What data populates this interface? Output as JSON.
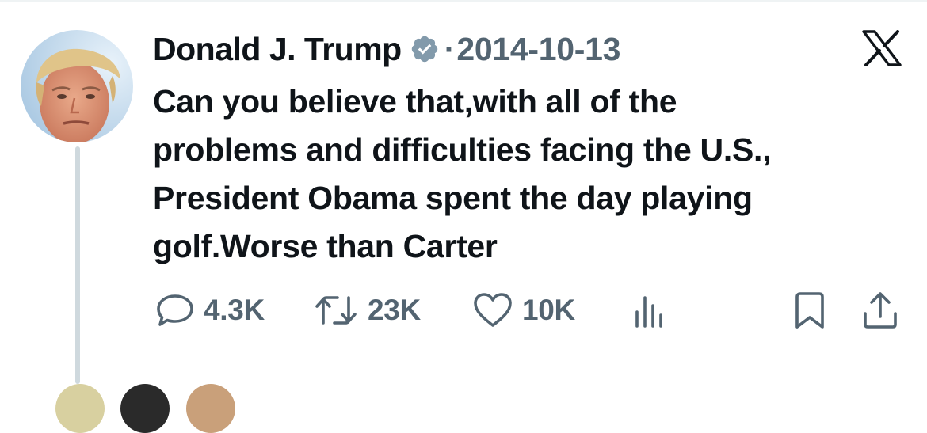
{
  "tweet": {
    "author_name": "Donald J. Trump",
    "verified": true,
    "separator": "·",
    "date": "2014-10-13",
    "text": "Can you believe that,with all of the\nproblems and difficulties facing the U.S.,\nPresident Obama spent the day playing\ngolf.Worse than Carter"
  },
  "actions": {
    "replies": "4.3K",
    "retweets": "23K",
    "likes": "10K"
  },
  "icons": {
    "brand": "x-logo-icon",
    "verified": "verified-badge-icon",
    "reply": "reply-icon",
    "retweet": "retweet-icon",
    "like": "heart-icon",
    "views": "views-icon",
    "bookmark": "bookmark-icon",
    "share": "share-icon"
  },
  "colors": {
    "text_primary": "#0f1419",
    "text_secondary": "#536471",
    "verified_badge": "#829aab",
    "thread_line": "#cfd9de"
  }
}
